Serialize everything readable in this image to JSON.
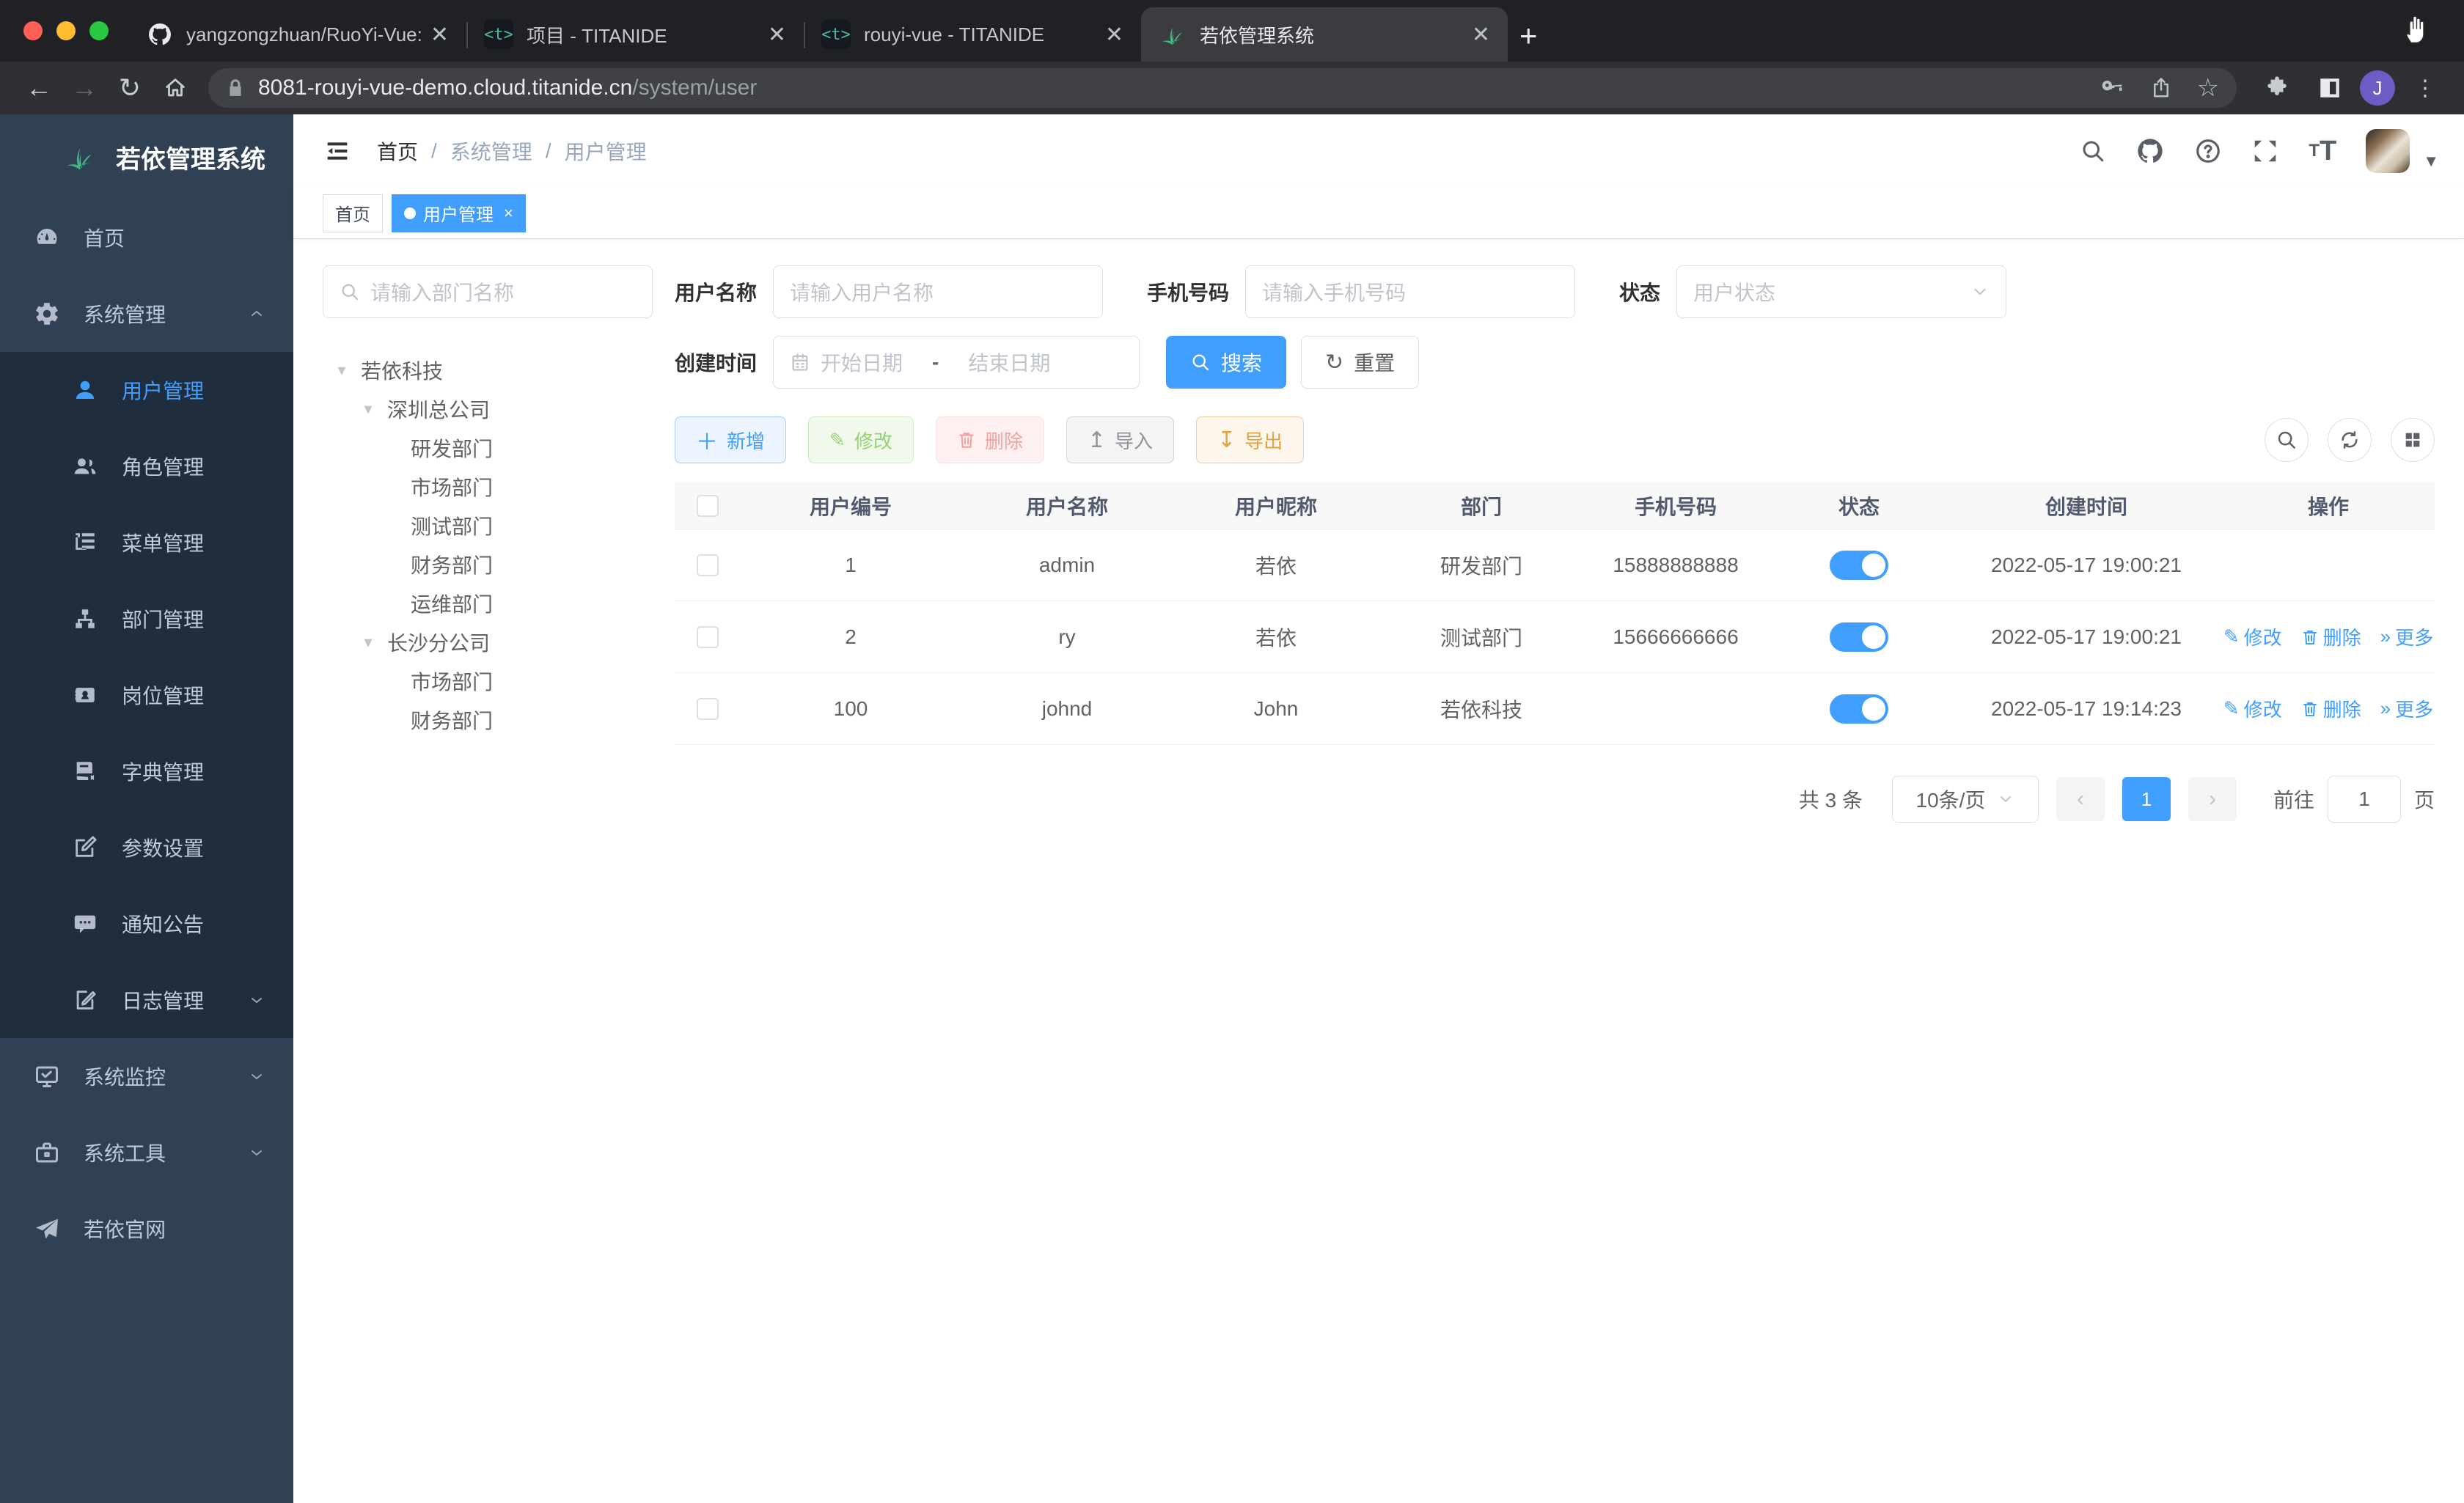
{
  "browser": {
    "tabs": [
      {
        "title": "yangzongzhuan/RuoYi-Vue: (Ru"
      },
      {
        "title": "项目 - TITANIDE"
      },
      {
        "title": "rouyi-vue - TITANIDE"
      },
      {
        "title": "若依管理系统"
      }
    ],
    "url": {
      "host": "8081-rouyi-vue-demo.cloud.titanide.cn",
      "path": "/system/user"
    },
    "profile_initial": "J"
  },
  "app": {
    "logo_title": "若依管理系统",
    "sidebar": {
      "items": [
        {
          "label": "首页"
        },
        {
          "label": "系统管理"
        },
        {
          "label": "用户管理"
        },
        {
          "label": "角色管理"
        },
        {
          "label": "菜单管理"
        },
        {
          "label": "部门管理"
        },
        {
          "label": "岗位管理"
        },
        {
          "label": "字典管理"
        },
        {
          "label": "参数设置"
        },
        {
          "label": "通知公告"
        },
        {
          "label": "日志管理"
        },
        {
          "label": "系统监控"
        },
        {
          "label": "系统工具"
        },
        {
          "label": "若依官网"
        }
      ]
    },
    "breadcrumb": {
      "home": "首页",
      "section": "系统管理",
      "page": "用户管理"
    },
    "tags": {
      "home": "首页",
      "current": "用户管理"
    },
    "dept": {
      "search_placeholder": "请输入部门名称",
      "tree": [
        {
          "label": "若依科技"
        },
        {
          "label": "深圳总公司"
        },
        {
          "label": "研发部门"
        },
        {
          "label": "市场部门"
        },
        {
          "label": "测试部门"
        },
        {
          "label": "财务部门"
        },
        {
          "label": "运维部门"
        },
        {
          "label": "长沙分公司"
        },
        {
          "label": "市场部门"
        },
        {
          "label": "财务部门"
        }
      ]
    },
    "filters": {
      "username_label": "用户名称",
      "username_placeholder": "请输入用户名称",
      "phone_label": "手机号码",
      "phone_placeholder": "请输入手机号码",
      "status_label": "状态",
      "status_placeholder": "用户状态",
      "created_label": "创建时间",
      "date_start": "开始日期",
      "date_separator": "-",
      "date_end": "结束日期",
      "search_label": "搜索",
      "reset_label": "重置"
    },
    "toolbar": {
      "add": "新增",
      "edit": "修改",
      "delete": "删除",
      "import": "导入",
      "export": "导出"
    },
    "table": {
      "columns": [
        "用户编号",
        "用户名称",
        "用户昵称",
        "部门",
        "手机号码",
        "状态",
        "创建时间",
        "操作"
      ],
      "action_labels": {
        "edit": "修改",
        "delete": "删除",
        "more": "更多"
      },
      "rows": [
        {
          "id": "1",
          "username": "admin",
          "nickname": "若依",
          "dept": "研发部门",
          "phone": "15888888888",
          "created": "2022-05-17 19:00:21"
        },
        {
          "id": "2",
          "username": "ry",
          "nickname": "若依",
          "dept": "测试部门",
          "phone": "15666666666",
          "created": "2022-05-17 19:00:21"
        },
        {
          "id": "100",
          "username": "johnd",
          "nickname": "John",
          "dept": "若依科技",
          "phone": "",
          "created": "2022-05-17 19:14:23"
        }
      ]
    },
    "pagination": {
      "total": "共 3 条",
      "page_size": "10条/页",
      "prev": "‹",
      "page": "1",
      "next": "›",
      "goto_label": "前往",
      "goto_value": "1",
      "unit_label": "页"
    }
  }
}
